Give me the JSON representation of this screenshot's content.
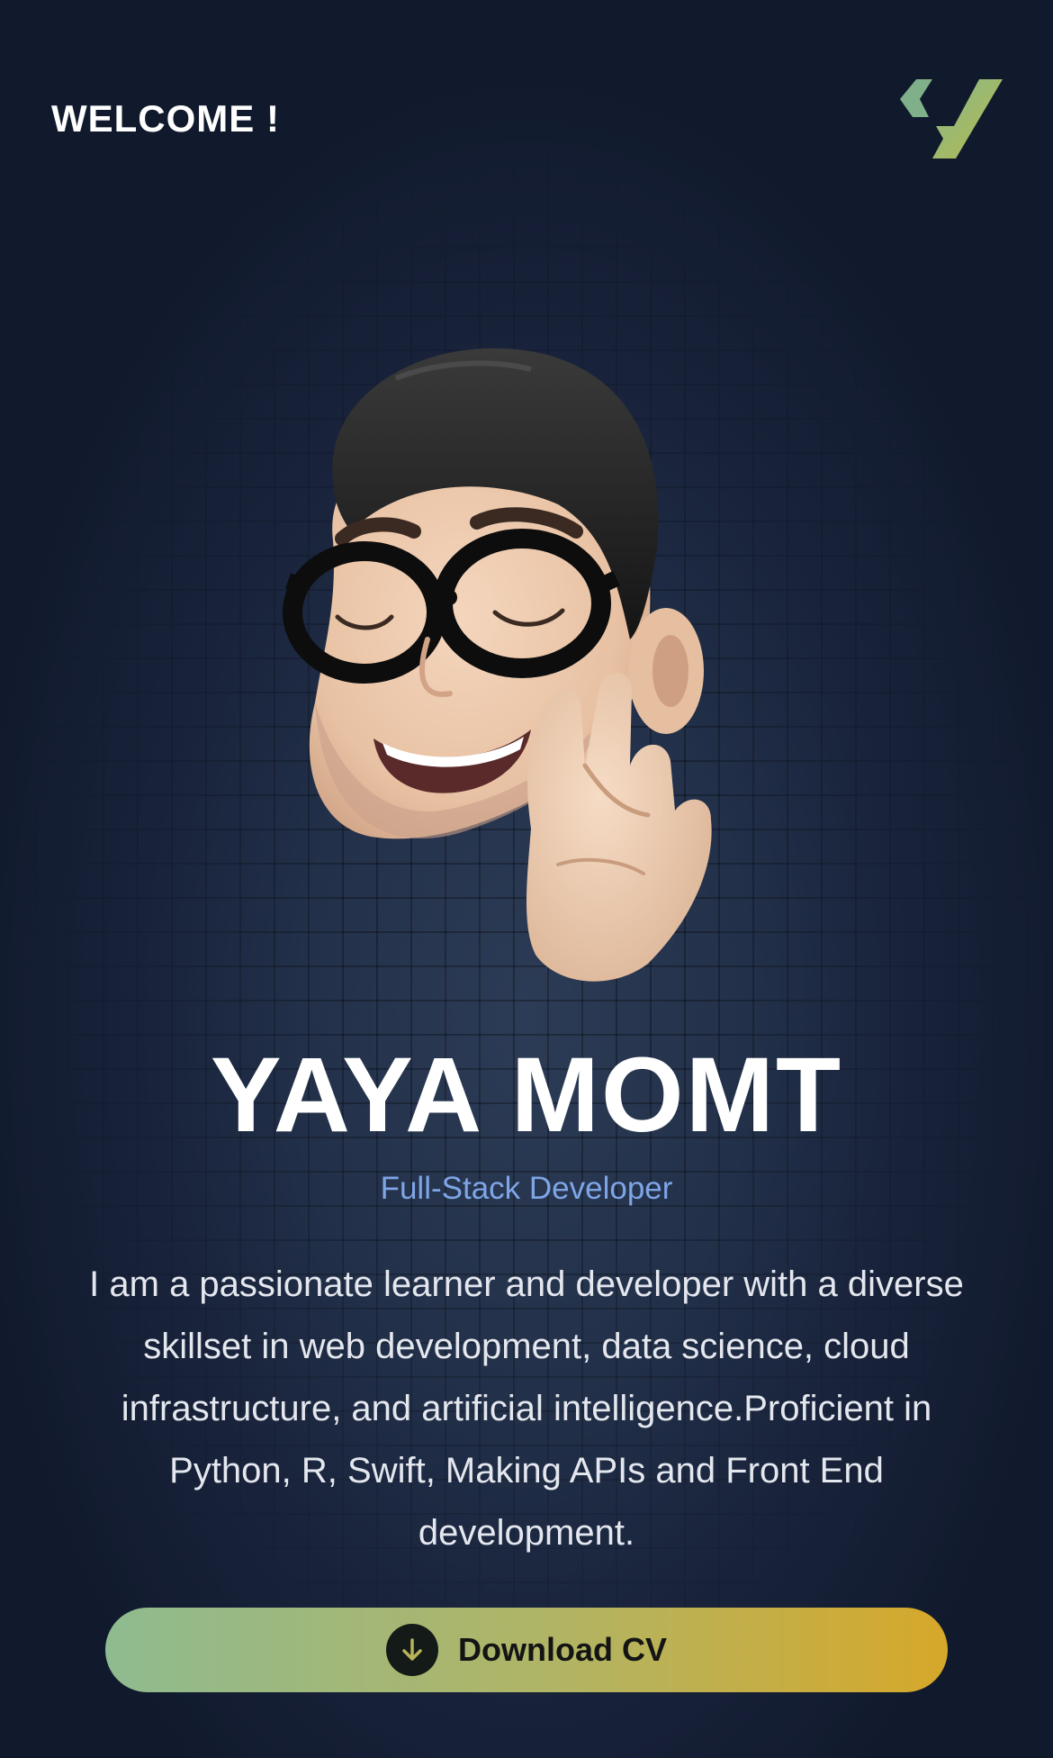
{
  "header": {
    "welcome_text": "WELCOME !",
    "logo_icon": "y-chevron-logo-icon"
  },
  "hero": {
    "avatar_icon": "memoji-avatar-fingers-crossed",
    "name": "YAYA MOMT",
    "role": "Full-Stack Developer",
    "bio": "I am a passionate learner and developer with a diverse skillset in web development, data science, cloud infrastructure, and artificial intelligence.Proficient in Python, R, Swift, Making APIs and Front End development."
  },
  "cv_button": {
    "label": "Download CV",
    "icon": "download-arrow-icon"
  },
  "colors": {
    "background": "#111a2c",
    "accent_blue": "#7ea5e6",
    "button_gradient_start": "#8fbb90",
    "button_gradient_end": "#d6a82a",
    "logo_green": "#8fbb78"
  }
}
